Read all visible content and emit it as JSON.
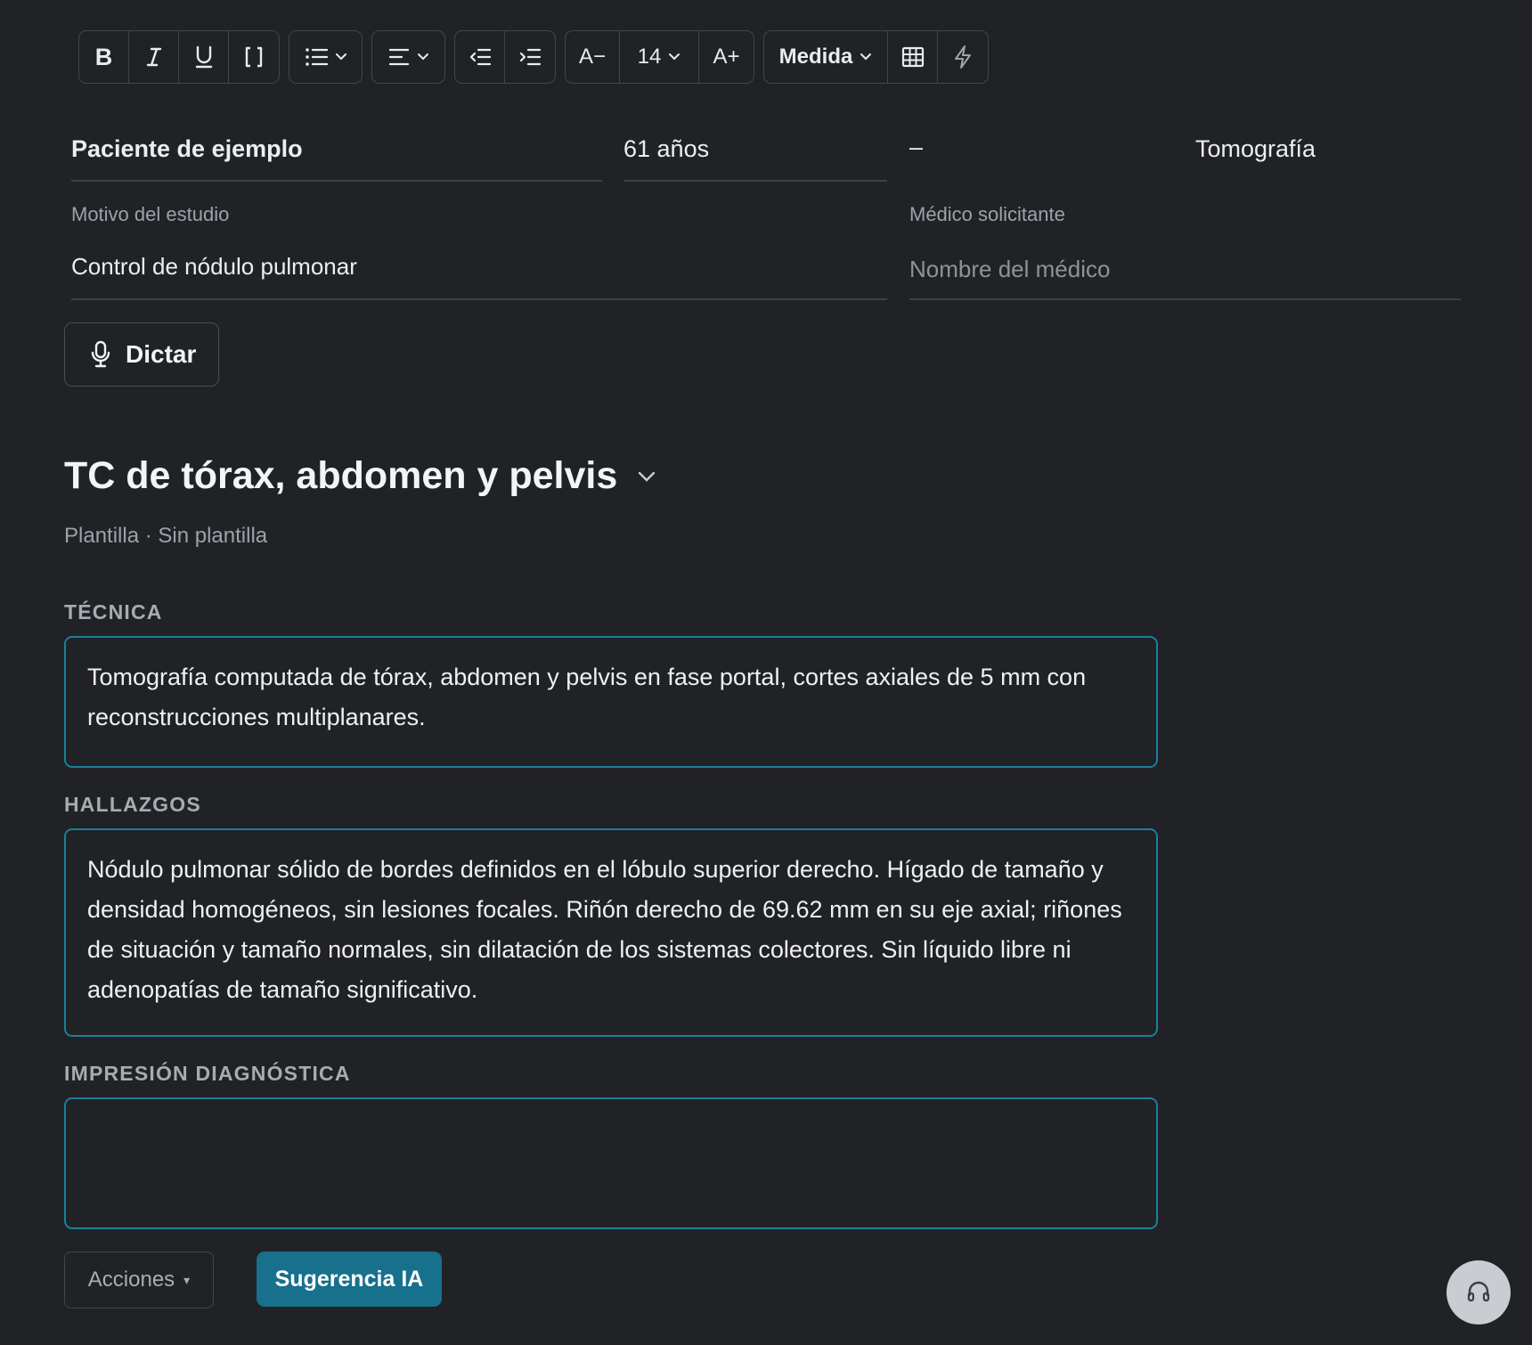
{
  "toolbar": {
    "bold_label": "B",
    "font_decrease_label": "A−",
    "font_size": "14",
    "font_increase_label": "A+",
    "style_label": "Medida"
  },
  "patient": {
    "name": "Paciente de ejemplo",
    "age": "61 años",
    "sex": "–",
    "modality": "Tomografía"
  },
  "study": {
    "reason_label": "Motivo del estudio",
    "reason_value": "Control de nódulo pulmonar",
    "doctor_label": "Médico solicitante",
    "doctor_placeholder": "Nombre del médico"
  },
  "dictate_label": "Dictar",
  "report": {
    "title": "TC de tórax, abdomen y pelvis",
    "template_text": "Plantilla · Sin plantilla",
    "sections": [
      {
        "label": "TÉCNICA",
        "text": "Tomografía computada de tórax, abdomen y pelvis en fase portal, cortes axiales de 5 mm con reconstrucciones multiplanares."
      },
      {
        "label": "HALLAZGOS",
        "text": "Nódulo pulmonar sólido de bordes definidos en el lóbulo superior derecho. Hígado de tamaño y densidad homogéneos, sin lesiones focales. Riñón derecho de 69.62 mm en su eje axial; riñones de situación y tamaño normales, sin dilatación de los sistemas colectores. Sin líquido libre ni adenopatías de tamaño significativo."
      },
      {
        "label": "IMPRESIÓN DIAGNÓSTICA",
        "text": ""
      }
    ]
  },
  "actions": {
    "acciones_label": "Acciones",
    "acciones_caret": "▾",
    "ai_label": "Sugerencia IA"
  },
  "colors": {
    "background": "#202226",
    "accent": "#1a8098",
    "ai_button": "#17708c"
  }
}
